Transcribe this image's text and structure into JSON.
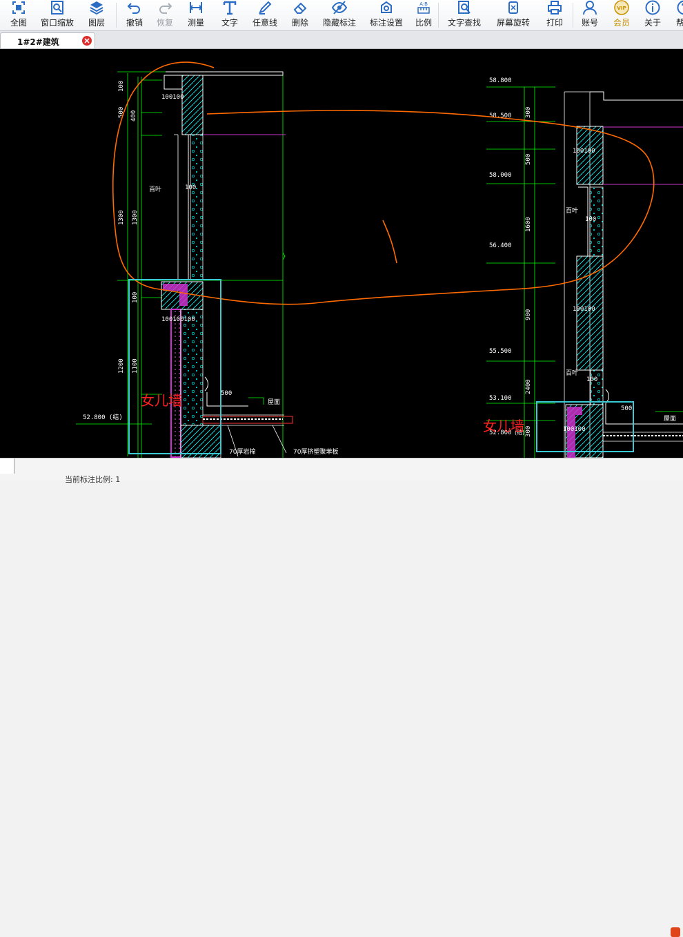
{
  "toolbar": {
    "items": [
      {
        "label": "全图",
        "icon": "full-view-icon"
      },
      {
        "label": "窗口缩放",
        "icon": "window-zoom-icon"
      },
      {
        "label": "图层",
        "icon": "layers-icon"
      },
      {
        "label": "撤销",
        "icon": "undo-icon"
      },
      {
        "label": "恢复",
        "icon": "redo-icon"
      },
      {
        "label": "测量",
        "icon": "measure-icon"
      },
      {
        "label": "文字",
        "icon": "text-icon"
      },
      {
        "label": "任意线",
        "icon": "pen-icon"
      },
      {
        "label": "删除",
        "icon": "eraser-icon"
      },
      {
        "label": "隐藏标注",
        "icon": "eye-hide-icon"
      },
      {
        "label": "标注设置",
        "icon": "annotation-settings-icon"
      },
      {
        "label": "比例",
        "icon": "scale-icon"
      },
      {
        "label": "文字查找",
        "icon": "text-search-icon"
      },
      {
        "label": "屏幕旋转",
        "icon": "screen-rotate-icon"
      },
      {
        "label": "打印",
        "icon": "printer-icon"
      },
      {
        "label": "账号",
        "icon": "account-icon"
      },
      {
        "label": "会员",
        "icon": "vip-icon"
      },
      {
        "label": "关于",
        "icon": "info-icon"
      },
      {
        "label": "帮助",
        "icon": "help-icon"
      }
    ],
    "vip_badge": "VIP",
    "ab_badge": "A:B"
  },
  "tab": {
    "label": "1#2#建筑"
  },
  "drawing": {
    "left_dims": [
      "100",
      "400",
      "500",
      "1300",
      "1300",
      "100",
      "1100",
      "1200"
    ],
    "left_wall_labels": [
      "100100",
      "100",
      "100100100"
    ],
    "left_elevation": "52.800 (结)",
    "right_elevations": [
      "58.800",
      "58.500",
      "58.000",
      "56.400",
      "55.500",
      "53.100",
      "52.800"
    ],
    "right_elevation_suffix": "(结)",
    "right_dims": [
      "300",
      "500",
      "1600",
      "900",
      "2400",
      "300"
    ],
    "right_wall_labels": [
      "100100",
      "100",
      "100100",
      "100",
      "100100"
    ],
    "louver_label": "百叶",
    "dim_500": "500",
    "roof_label": "屋面",
    "note_70_rock": "70厚岩棉",
    "note_70_board": "70厚挤塑聚苯板",
    "parapet_label": "女儿墙",
    "colors": {
      "bg": "#000000",
      "green": "#00ff00",
      "white": "#ffffff",
      "cyan": "#00ffff",
      "magenta": "#cc33cc",
      "markup_orange": "#ff6a00",
      "markup_red": "#ff2020",
      "cyan_box": "#3cc9d6"
    }
  },
  "status": {
    "text": "当前标注比例: 1"
  },
  "colors": {
    "toolbar_icon": "#2b6cc4",
    "vip_gold": "#c89000",
    "tab_close": "#e02b2b"
  }
}
